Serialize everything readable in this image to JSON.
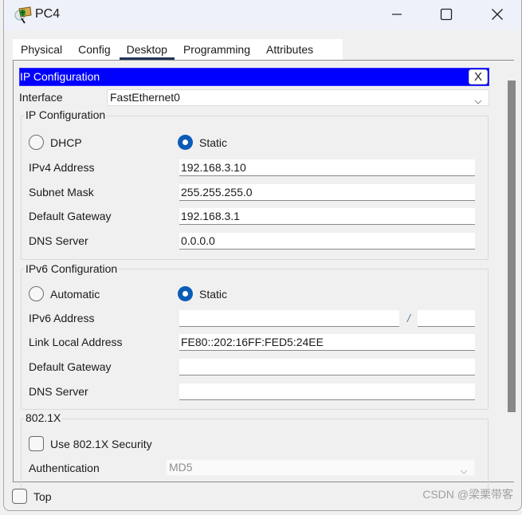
{
  "window": {
    "title": "PC4",
    "app_icon": "pc-device-icon",
    "controls": {
      "minimize": "minimize-icon",
      "maximize": "maximize-icon",
      "close": "close-icon"
    }
  },
  "tabs": [
    {
      "label": "Physical",
      "active": false
    },
    {
      "label": "Config",
      "active": false
    },
    {
      "label": "Desktop",
      "active": true
    },
    {
      "label": "Programming",
      "active": false
    },
    {
      "label": "Attributes",
      "active": false
    }
  ],
  "ip_config": {
    "header_title": "IP Configuration",
    "close_label": "X",
    "interface_label": "Interface",
    "interface_value": "FastEthernet0",
    "ipv4": {
      "group_title": "IP Configuration",
      "dhcp_label": "DHCP",
      "static_label": "Static",
      "mode": "Static",
      "fields": [
        {
          "label": "IPv4 Address",
          "value": "192.168.3.10"
        },
        {
          "label": "Subnet Mask",
          "value": "255.255.255.0"
        },
        {
          "label": "Default Gateway",
          "value": "192.168.3.1"
        },
        {
          "label": "DNS Server",
          "value": "0.0.0.0"
        }
      ]
    },
    "ipv6": {
      "group_title": "IPv6 Configuration",
      "auto_label": "Automatic",
      "static_label": "Static",
      "mode": "Static",
      "address_label": "IPv6 Address",
      "address_value": "",
      "prefix_separator": "/",
      "prefix_value": "",
      "link_local_label": "Link Local Address",
      "link_local_value": "FE80::202:16FF:FED5:24EE",
      "gateway_label": "Default Gateway",
      "gateway_value": "",
      "dns_label": "DNS Server",
      "dns_value": ""
    },
    "dot1x": {
      "group_title": "802.1X",
      "use_label": "Use 802.1X Security",
      "use_checked": false,
      "auth_label": "Authentication",
      "auth_value": "MD5"
    }
  },
  "footer": {
    "top_label": "Top",
    "top_checked": false,
    "watermark": "CSDN @梁栗带客"
  }
}
